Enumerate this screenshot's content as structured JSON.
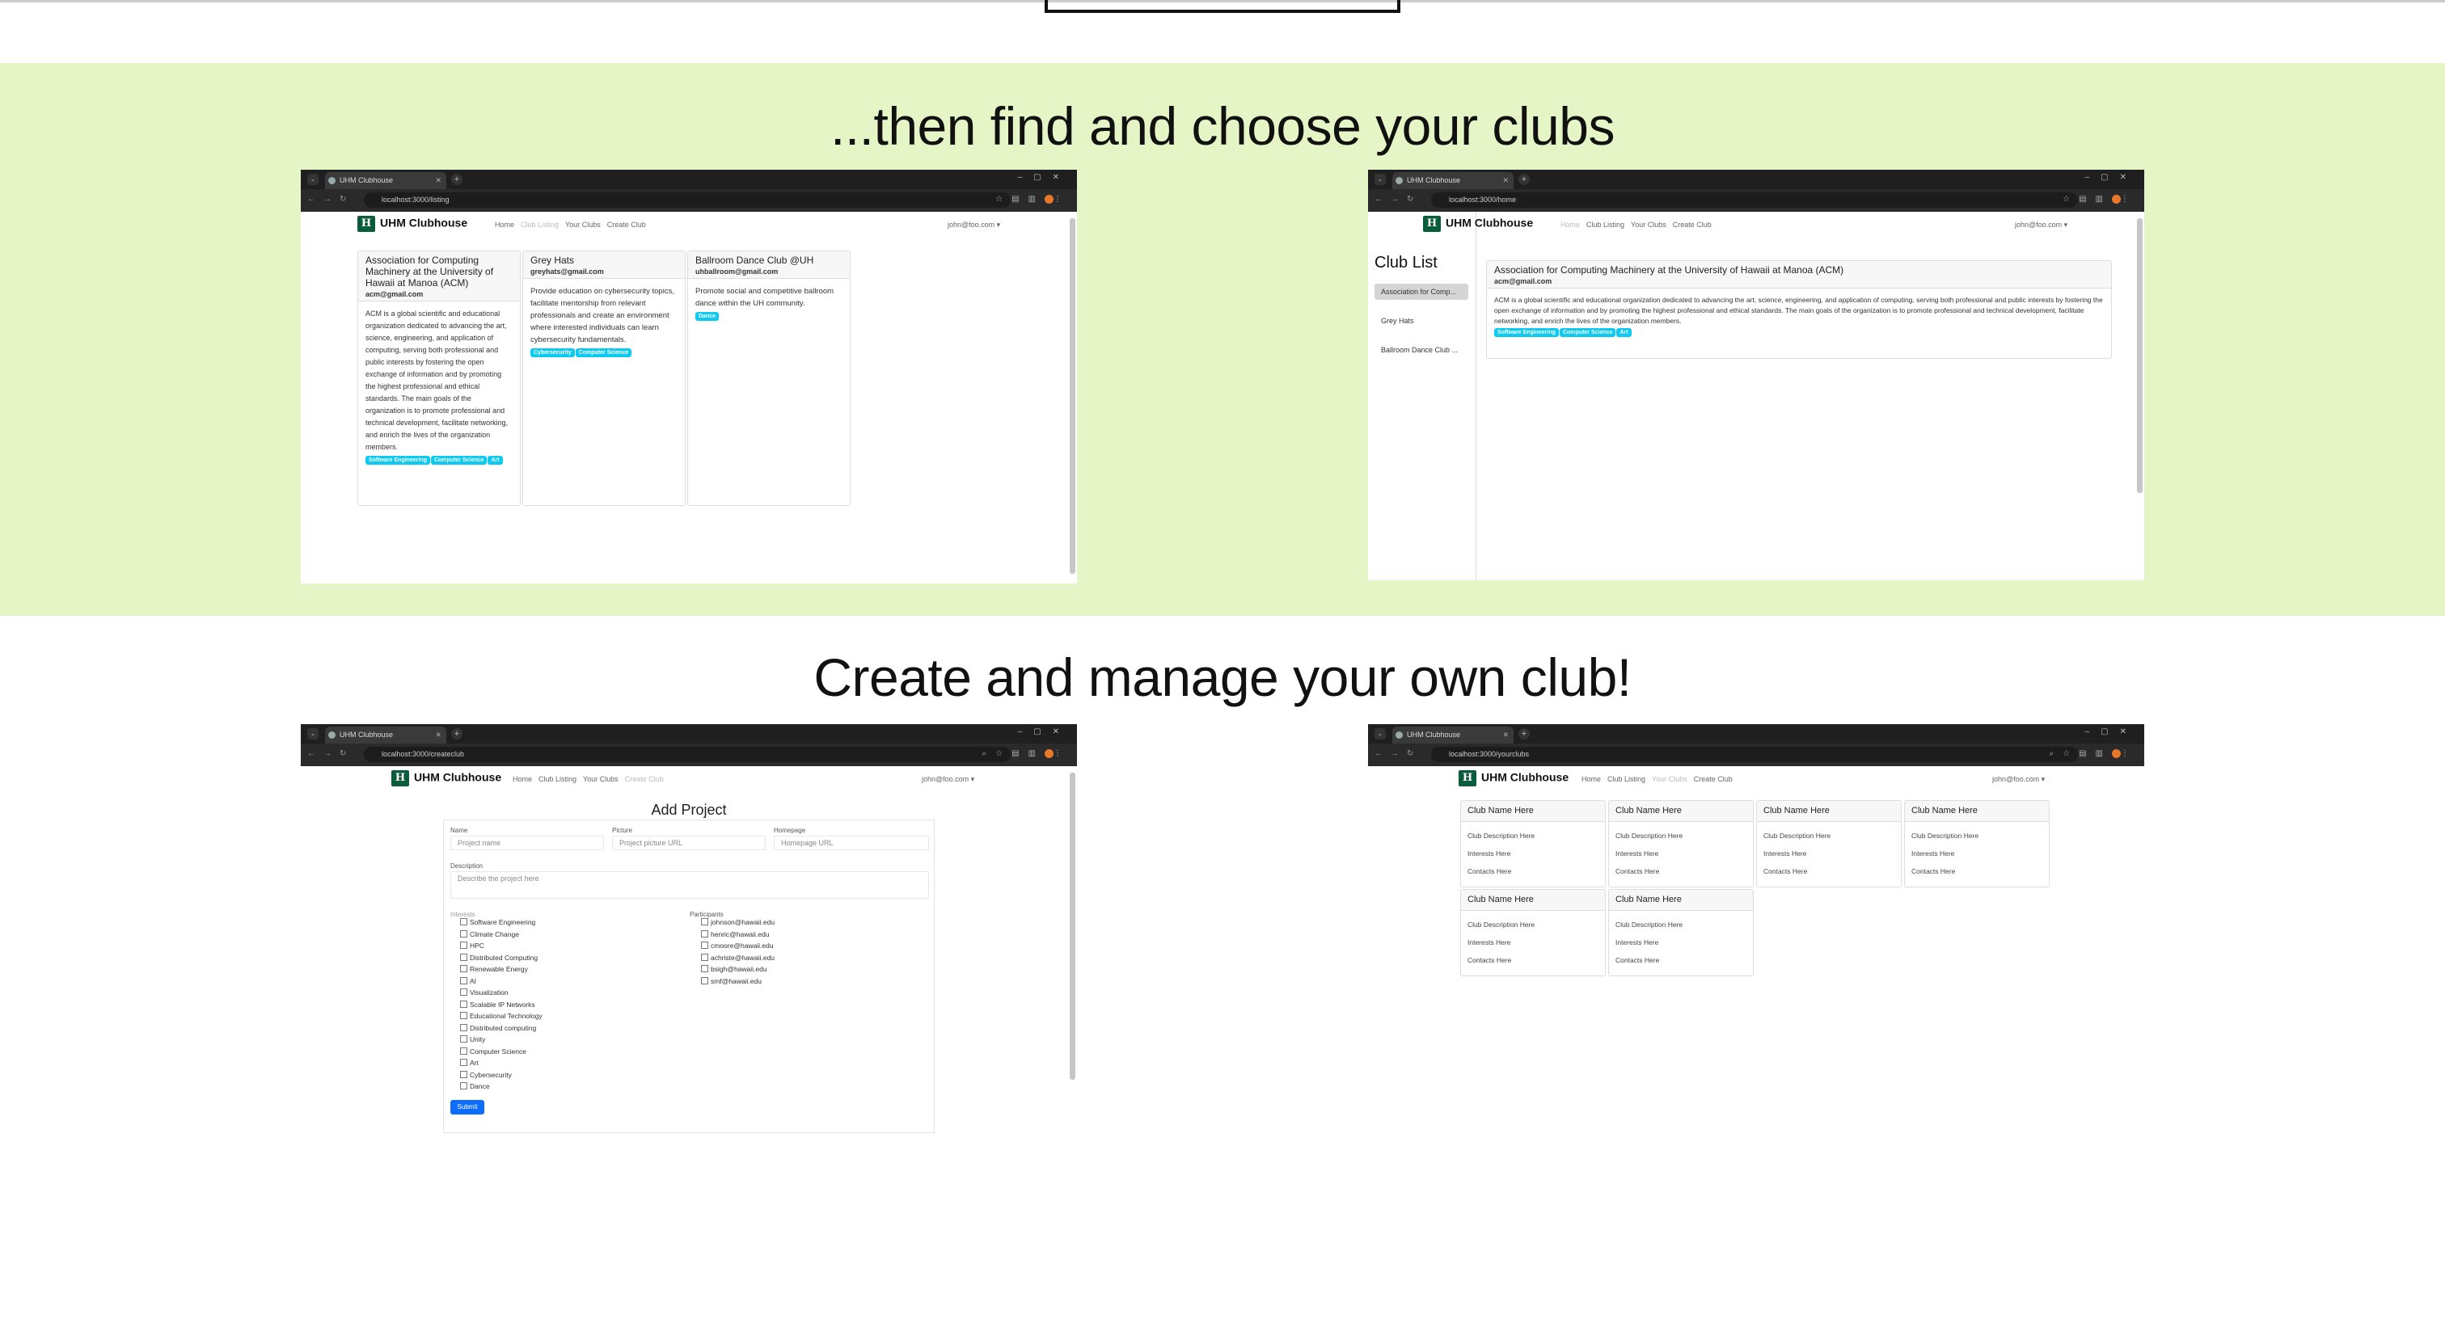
{
  "headings": {
    "find": "...then find and choose your clubs",
    "create": "Create and manage your own club!"
  },
  "browser": {
    "tab_title": "UHM Clubhouse",
    "urls": [
      "localhost:3000/listing",
      "localhost:3000/home",
      "localhost:3000/createclub",
      "localhost:3000/yourclubs"
    ]
  },
  "app": {
    "brand": "UHM Clubhouse",
    "nav": [
      "Home",
      "Club Listing",
      "Your Clubs",
      "Create Club"
    ],
    "user": "john@foo.com ▾"
  },
  "listing": {
    "cards": [
      {
        "title": "Association for Computing Machinery at the University of Hawaii at Manoa (ACM)",
        "email": "acm@gmail.com",
        "desc": "ACM is a global scientific and educational organization dedicated to advancing the art, science, engineering, and application of computing, serving both professional and public interests by fostering the open exchange of information and by promoting the highest professional and ethical standards. The main goals of the organization is to promote professional and technical development, facilitate networking, and enrich the lives of the organization members.",
        "tags": [
          "Software Engineering",
          "Computer Science",
          "Art"
        ]
      },
      {
        "title": "Grey Hats",
        "email": "greyhats@gmail.com",
        "desc": "Provide education on cybersecurity topics, facilitate mentorship from relevant professionals and create an environment where interested individuals can learn cybersecurity fundamentals.",
        "tags": [
          "Cybersecurity",
          "Computer Science"
        ]
      },
      {
        "title": "Ballroom Dance Club @UH",
        "email": "uhballroom@gmail.com",
        "desc": "Promote social and competitive ballroom dance within the UH community.",
        "tags": [
          "Dance"
        ]
      }
    ]
  },
  "home": {
    "list_title": "Club List",
    "items": [
      "Association for Comp...",
      "Grey Hats",
      "Ballroom Dance Club ..."
    ],
    "detail": {
      "title": "Association for Computing Machinery at the University of Hawaii at Manoa (ACM)",
      "email": "acm@gmail.com",
      "desc": "ACM is a global scientific and educational organization dedicated to advancing the art, science, engineering, and application of computing, serving both professional and public interests by fostering the open exchange of information and by promoting the highest professional and ethical standards. The main goals of the organization is to promote professional and technical development, facilitate networking, and enrich the lives of the organization members.",
      "tags": [
        "Software Engineering",
        "Computer Science",
        "Art"
      ]
    }
  },
  "create": {
    "title": "Add Project",
    "labels": {
      "name": "Name",
      "picture": "Picture",
      "homepage": "Homepage",
      "description": "Description",
      "interests": "Interests",
      "participants": "Participants"
    },
    "placeholders": {
      "name": "Project name",
      "picture": "Project picture URL",
      "homepage": "Homepage URL",
      "description": "Describe the project here"
    },
    "interests": [
      "Software Engineering",
      "Climate Change",
      "HPC",
      "Distributed Computing",
      "Renewable Energy",
      "AI",
      "Visualization",
      "Scalable IP Networks",
      "Educational Technology",
      "Distributed computing",
      "Unity",
      "Computer Science",
      "Art",
      "Cybersecurity",
      "Dance"
    ],
    "participants": [
      "johnson@hawaii.edu",
      "henric@hawaii.edu",
      "cmoore@hawaii.edu",
      "achriste@hawaii.edu",
      "bsigh@hawaii.edu",
      "smf@hawaii.edu"
    ],
    "submit": "Submit"
  },
  "yourclubs": {
    "cards": [
      {
        "name": "Club Name Here",
        "desc": "Club Description Here",
        "interests": "Interests Here",
        "contacts": "Contacts Here"
      },
      {
        "name": "Club Name Here",
        "desc": "Club Description Here",
        "interests": "Interests Here",
        "contacts": "Contacts Here"
      },
      {
        "name": "Club Name Here",
        "desc": "Club Description Here",
        "interests": "Interests Here",
        "contacts": "Contacts Here"
      },
      {
        "name": "Club Name Here",
        "desc": "Club Description Here",
        "interests": "Interests Here",
        "contacts": "Contacts Here"
      },
      {
        "name": "Club Name Here",
        "desc": "Club Description Here",
        "interests": "Interests Here",
        "contacts": "Contacts Here"
      },
      {
        "name": "Club Name Here",
        "desc": "Club Description Here",
        "interests": "Interests Here",
        "contacts": "Contacts Here"
      }
    ]
  }
}
